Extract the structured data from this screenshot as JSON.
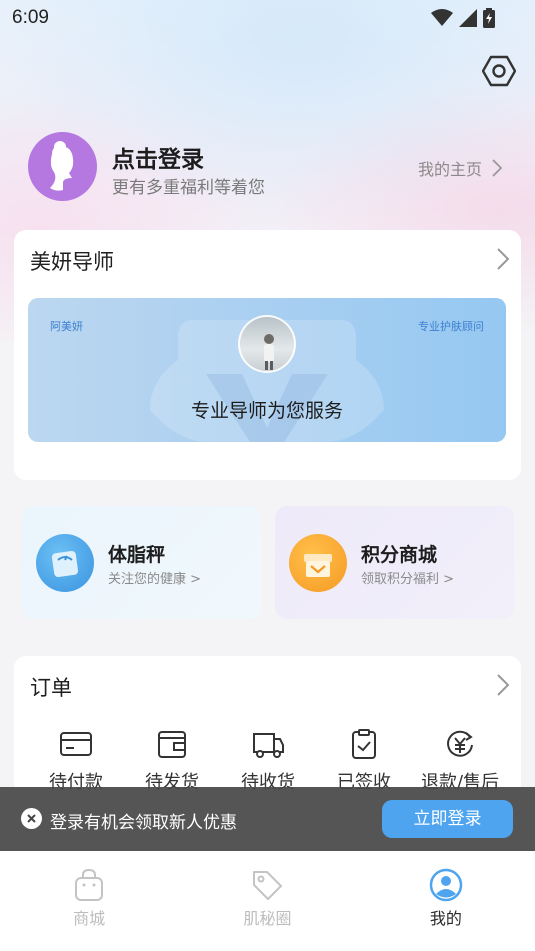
{
  "status_bar": {
    "time": "6:09"
  },
  "profile": {
    "title": "点击登录",
    "subtitle": "更有多重福利等着您",
    "homepage_link": "我的主页"
  },
  "advisor": {
    "title": "美妍导师",
    "name": "阿美妍",
    "role": "专业护肤顾问",
    "slogan": "专业导师为您服务"
  },
  "scale": {
    "title": "体脂秤",
    "subtitle": "关注您的健康 >"
  },
  "points_mall": {
    "title": "积分商城",
    "subtitle": "领取积分福利 >"
  },
  "orders": {
    "title": "订单",
    "items": [
      {
        "label": "待付款",
        "icon": "card-icon"
      },
      {
        "label": "待发货",
        "icon": "wallet-icon"
      },
      {
        "label": "待收货",
        "icon": "truck-icon"
      },
      {
        "label": "已签收",
        "icon": "clipboard-check-icon"
      },
      {
        "label": "退款/售后",
        "icon": "refund-yen-icon"
      }
    ]
  },
  "toast": {
    "text": "登录有机会领取新人优惠",
    "button": "立即登录"
  },
  "tabbar": {
    "tabs": [
      {
        "label": "商城",
        "icon": "shopping-bag-icon",
        "active": false
      },
      {
        "label": "肌秘圈",
        "icon": "tag-icon",
        "active": false
      },
      {
        "label": "我的",
        "icon": "user-circle-icon",
        "active": true
      }
    ]
  },
  "colors": {
    "accent": "#4ea4ef",
    "avatar_bg": "#b478e0",
    "toast_bg": "#464648"
  }
}
